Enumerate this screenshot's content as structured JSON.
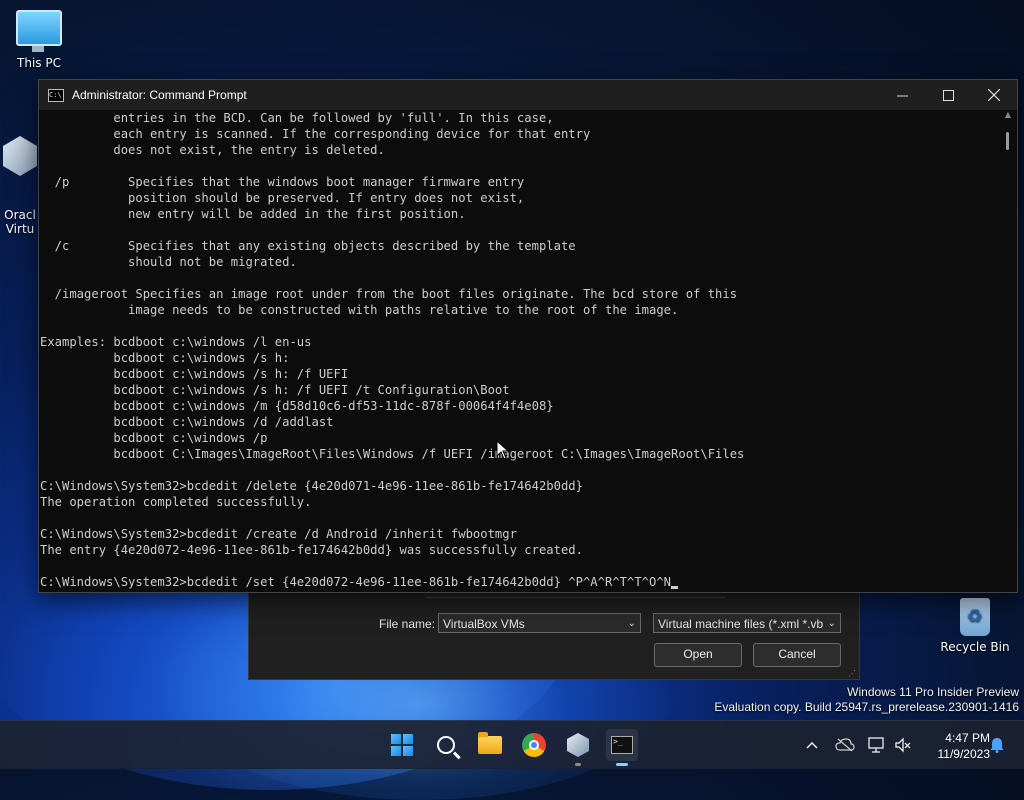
{
  "desktop": {
    "icons": [
      {
        "label": "This PC"
      },
      {
        "label": "Oracl\nVirtu"
      }
    ],
    "recycle_bin": "Recycle Bin"
  },
  "cmd": {
    "title": "Administrator: Command Prompt",
    "icon_glyph": "C:\\",
    "lines": [
      "          entries in the BCD. Can be followed by 'full'. In this case,",
      "          each entry is scanned. If the corresponding device for that entry",
      "          does not exist, the entry is deleted.",
      "",
      "  /p        Specifies that the windows boot manager firmware entry",
      "            position should be preserved. If entry does not exist,",
      "            new entry will be added in the first position.",
      "",
      "  /c        Specifies that any existing objects described by the template",
      "            should not be migrated.",
      "",
      "  /imageroot Specifies an image root under from the boot files originate. The bcd store of this",
      "            image needs to be constructed with paths relative to the root of the image.",
      "",
      "Examples: bcdboot c:\\windows /l en-us",
      "          bcdboot c:\\windows /s h:",
      "          bcdboot c:\\windows /s h: /f UEFI",
      "          bcdboot c:\\windows /s h: /f UEFI /t Configuration\\Boot",
      "          bcdboot c:\\windows /m {d58d10c6-df53-11dc-878f-00064f4f4e08}",
      "          bcdboot c:\\windows /d /addlast",
      "          bcdboot c:\\windows /p",
      "          bcdboot C:\\Images\\ImageRoot\\Files\\Windows /f UEFI /imageroot C:\\Images\\ImageRoot\\Files",
      "",
      "C:\\Windows\\System32>bcdedit /delete {4e20d071-4e96-11ee-861b-fe174642b0dd}",
      "The operation completed successfully.",
      "",
      "C:\\Windows\\System32>bcdedit /create /d Android /inherit fwbootmgr",
      "The entry {4e20d072-4e96-11ee-861b-fe174642b0dd} was successfully created.",
      "",
      "C:\\Windows\\System32>bcdedit /set {4e20d072-4e96-11ee-861b-fe174642b0dd} ^P^A^R^T^T^O^N"
    ]
  },
  "dialog": {
    "file_name_label": "File name:",
    "file_name_value": "VirtualBox VMs",
    "file_type_value": "Virtual machine files (*.xml *.vb",
    "open_label": "Open",
    "cancel_label": "Cancel"
  },
  "watermark": {
    "line1": "Windows 11 Pro Insider Preview",
    "line2": "Evaluation copy. Build 25947.rs_prerelease.230901-1416"
  },
  "taskbar": {
    "time": "4:47 PM",
    "date": "11/9/2023"
  }
}
